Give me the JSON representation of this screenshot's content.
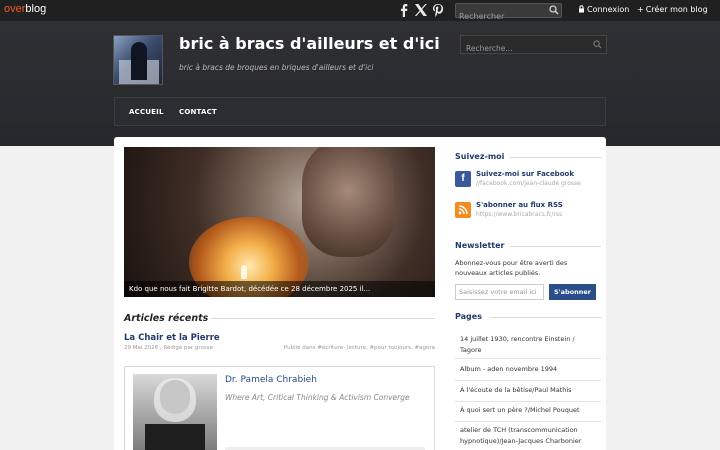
{
  "topbar": {
    "logo_highlight": "over",
    "logo_rest": "blog",
    "search_placeholder": "Rechercher",
    "login_label": "Connexion",
    "create_label": "Créer mon blog",
    "social_icons": [
      "facebook-icon",
      "x-icon",
      "pinterest-icon"
    ]
  },
  "header": {
    "title": "bric à bracs d'ailleurs et d'ici",
    "subtitle": "bric à bracs de broques en briques d'ailleurs et d'ici",
    "search_placeholder": "Recherche..."
  },
  "nav": {
    "items": [
      "ACCUEIL",
      "CONTACT"
    ]
  },
  "hero": {
    "caption": "Kdo que nous fait Brigitte Bardot, décédée ce 28 décembre 2025 il..."
  },
  "recent": {
    "heading": "Articles récents",
    "article": {
      "title": "La Chair et la Pierre",
      "meta": "29 Mai 2026 , Rédigé par grosse",
      "tags": "Publié dans #écriture- lecture, #pour toujours, #agora"
    },
    "embed": {
      "name": "Dr. Pamela Chrabieh",
      "tagline": "Where Art, Critical Thinking & Activism Converge"
    }
  },
  "sidebar": {
    "follow": {
      "heading": "Suivez-moi",
      "facebook_label": "Suivez-moi sur Facebook",
      "facebook_url": "//facebook.com/jean-claude grosse",
      "rss_label": "S'abonner au flux RSS",
      "rss_url": "https://www.bricabracs.fr/rss"
    },
    "newsletter": {
      "heading": "Newsletter",
      "text": "Abonnez-vous pour être averti des nouveaux articles publiés.",
      "email_placeholder": "Saisissez votre email ici",
      "button_label": "S'abonner"
    },
    "pages": {
      "heading": "Pages",
      "items": [
        "14 juillet 1930, rencontre Einstein / Tagore",
        "Album - aden novembre 1994",
        "À l'écoute de la bêtise/Paul Mathis",
        "À quoi sert un père ?/Michel Pouquet",
        "atelier de TCH (transcommunication hypnotique)/Jean-Jacques Charbonier"
      ]
    }
  },
  "colors": {
    "brand": "#f25a29",
    "link": "#1f3a6b",
    "facebook": "#3b5998",
    "rss": "#f28c1e",
    "button": "#2a4e8a"
  }
}
